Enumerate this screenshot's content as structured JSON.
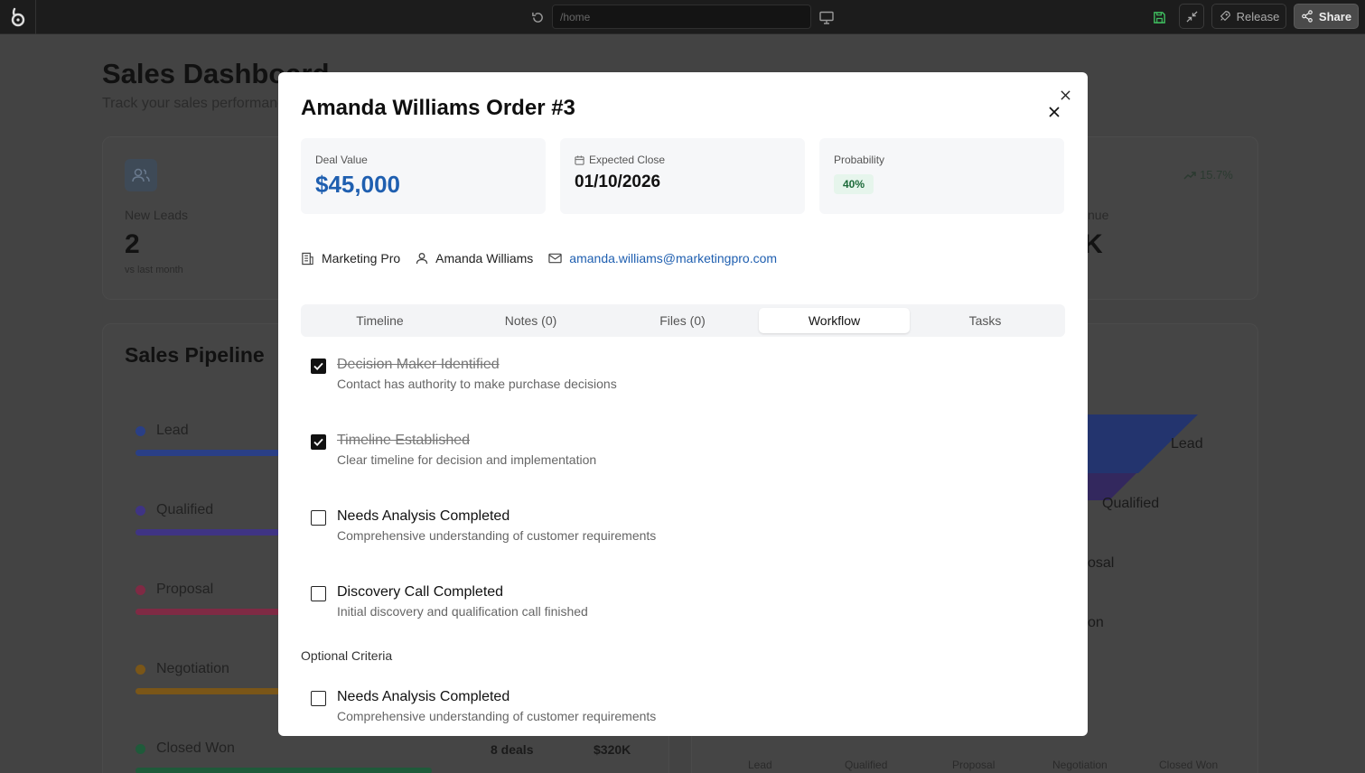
{
  "topbar": {
    "url_placeholder": "/home",
    "release_label": "Release",
    "share_label": "Share"
  },
  "dashboard": {
    "title": "Sales Dashboard",
    "subtitle": "Track your sales performance",
    "stats": {
      "new_leads_label": "New Leads",
      "new_leads_value": "2",
      "new_leads_foot": "vs last month",
      "revenue_label": "nue",
      "revenue_value": "K",
      "trend": "15.7%"
    },
    "pipeline": {
      "title": "Sales Pipeline",
      "stages": [
        {
          "label": "Lead",
          "color": "#2a3f86"
        },
        {
          "label": "Qualified",
          "color": "#3f3484"
        },
        {
          "label": "Proposal",
          "color": "#7f2a44"
        },
        {
          "label": "Negotiation",
          "color": "#7a5618"
        },
        {
          "label": "Closed Won",
          "color": "#1f5a3a"
        }
      ],
      "closed_won_deals": "8 deals",
      "closed_won_amount": "$320K"
    },
    "funnel": {
      "labels": [
        "Lead",
        "Qualified",
        "osal",
        "on"
      ],
      "x_labels": [
        "Lead",
        "Qualified",
        "Proposal",
        "Negotiation",
        "Closed Won"
      ]
    }
  },
  "modal": {
    "title": "Amanda Williams Order #3",
    "deal_value_label": "Deal Value",
    "deal_value": "$45,000",
    "expected_close_label": "Expected Close",
    "expected_close": "01/10/2026",
    "probability_label": "Probability",
    "probability": "40%",
    "company": "Marketing Pro",
    "contact": "Amanda Williams",
    "email": "amanda.williams@marketingpro.com",
    "tabs": [
      "Timeline",
      "Notes (0)",
      "Files (0)",
      "Workflow",
      "Tasks"
    ],
    "active_tab": "Workflow",
    "checklist": [
      {
        "title": "Decision Maker Identified",
        "desc": "Contact has authority to make purchase decisions",
        "checked": true
      },
      {
        "title": "Timeline Established",
        "desc": "Clear timeline for decision and implementation",
        "checked": true
      },
      {
        "title": "Needs Analysis Completed",
        "desc": "Comprehensive understanding of customer requirements",
        "checked": false
      },
      {
        "title": "Discovery Call Completed",
        "desc": "Initial discovery and qualification call finished",
        "checked": false
      }
    ],
    "optional_label": "Optional Criteria",
    "optional": [
      {
        "title": "Needs Analysis Completed",
        "desc": "Comprehensive understanding of customer requirements",
        "checked": false
      }
    ]
  },
  "colors": {
    "accent_blue": "#1f5fb0",
    "badge_green_bg": "#e6f5ec",
    "badge_green_text": "#1c6b3a",
    "save_green": "#3fbf5f"
  }
}
